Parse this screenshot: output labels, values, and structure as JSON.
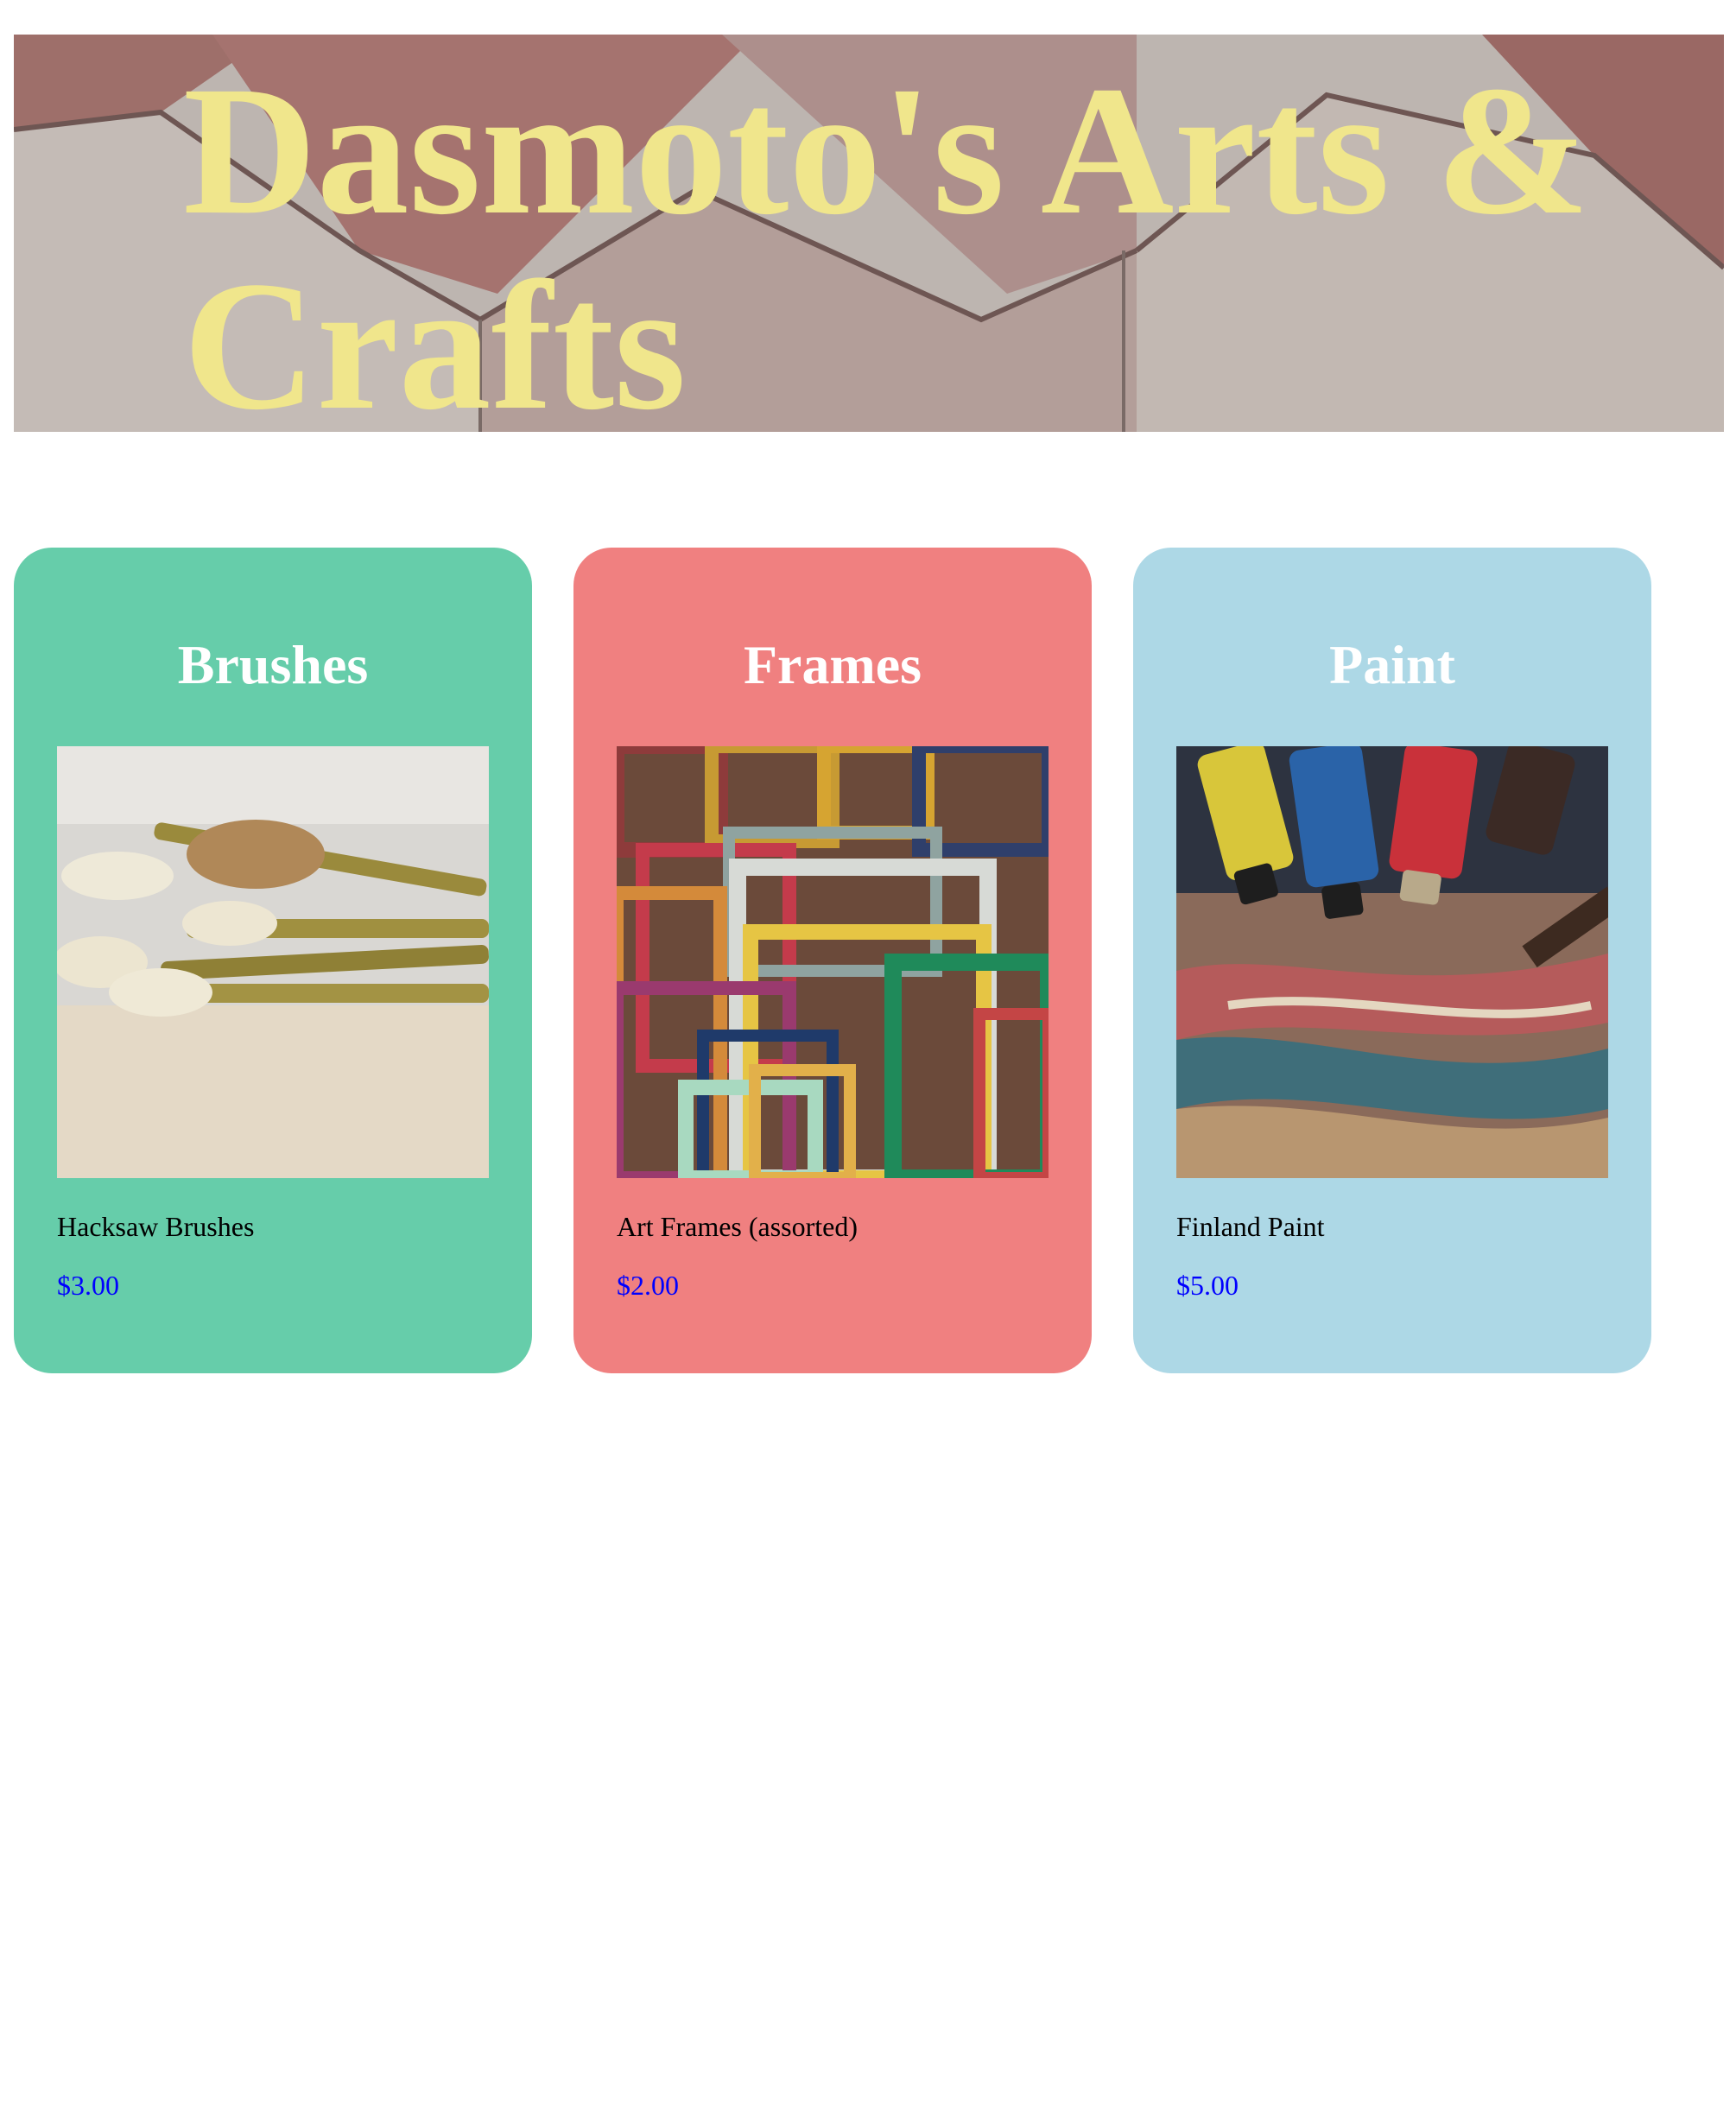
{
  "header": {
    "title": "Dasmoto's Arts & Crafts",
    "title_color": "#f0e68c"
  },
  "products": [
    {
      "category": "Brushes",
      "name": "Hacksaw Brushes",
      "price": "$3.00",
      "card_color": "#66cdaa",
      "image": "brushes-photo"
    },
    {
      "category": "Frames",
      "name": "Art Frames (assorted)",
      "price": "$2.00",
      "card_color": "#f08080",
      "image": "frames-photo"
    },
    {
      "category": "Paint",
      "name": "Finland Paint",
      "price": "$5.00",
      "card_color": "#add8e6",
      "image": "paint-photo"
    }
  ],
  "price_color": "#0000ff"
}
